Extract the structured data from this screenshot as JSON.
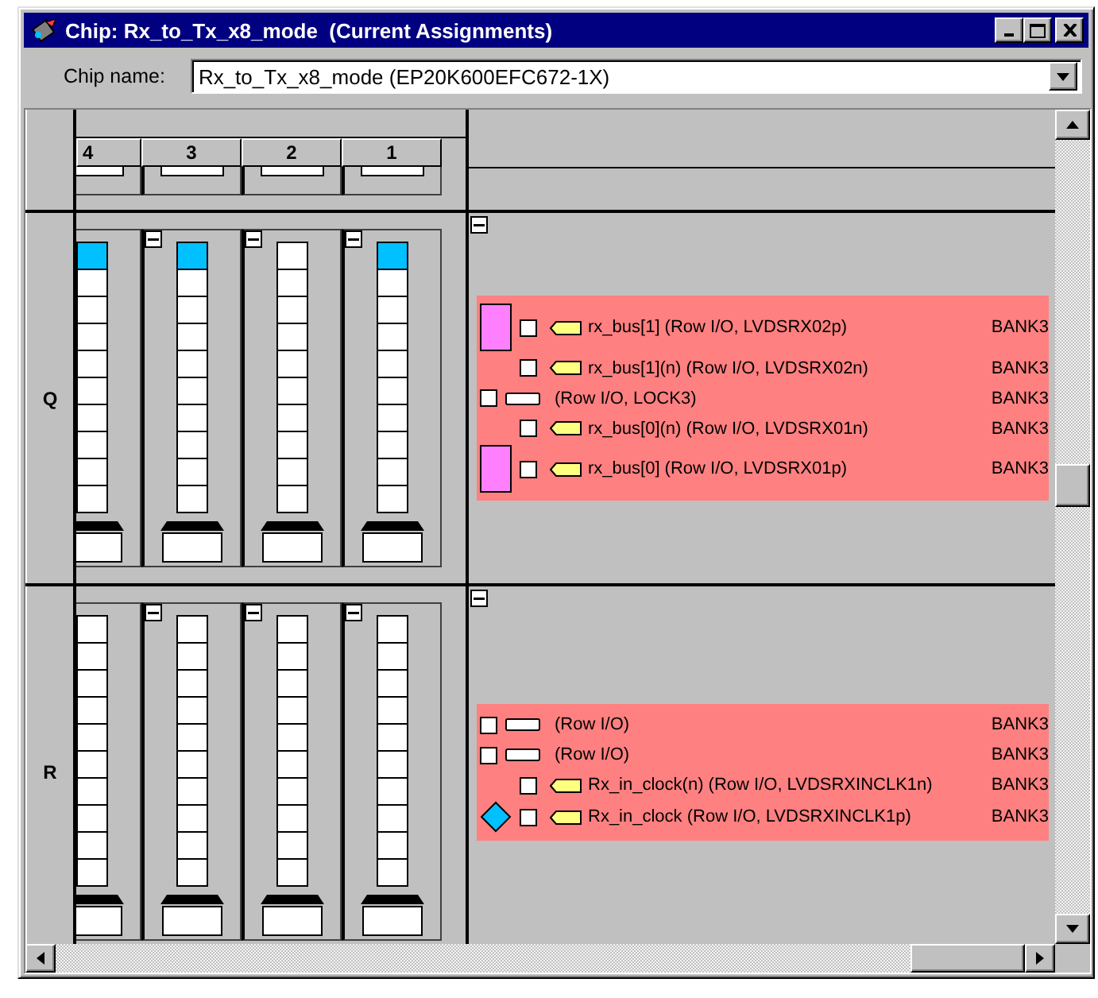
{
  "window": {
    "title": "Chip: Rx_to_Tx_x8_mode  (Current Assignments)"
  },
  "chip_name": {
    "label": "Chip name:",
    "value": "Rx_to_Tx_x8_mode (EP20K600EFC672-1X)"
  },
  "columns": [
    "4",
    "3",
    "2",
    "1"
  ],
  "rows": [
    {
      "label": "Q",
      "columns": [
        {
          "first_pin_assigned": true
        },
        {
          "first_pin_assigned": true
        },
        {
          "first_pin_assigned": false
        },
        {
          "first_pin_assigned": true
        }
      ],
      "assignments": [
        {
          "kind": "signal",
          "bar_marker": true,
          "diamond_marker": false,
          "checked": false,
          "text": "rx_bus[1] (Row I/O, LVDSRX02p)",
          "bank": "BANK3"
        },
        {
          "kind": "signal",
          "bar_marker": false,
          "diamond_marker": false,
          "checked": false,
          "text": "rx_bus[1](n) (Row I/O, LVDSRX02n)",
          "bank": "BANK3"
        },
        {
          "kind": "unassigned",
          "bar_marker": false,
          "diamond_marker": false,
          "checked": false,
          "text": "(Row I/O, LOCK3)",
          "bank": "BANK3"
        },
        {
          "kind": "signal",
          "bar_marker": false,
          "diamond_marker": false,
          "checked": false,
          "text": "rx_bus[0](n) (Row I/O, LVDSRX01n)",
          "bank": "BANK3"
        },
        {
          "kind": "signal",
          "bar_marker": true,
          "diamond_marker": false,
          "checked": false,
          "text": "rx_bus[0] (Row I/O, LVDSRX01p)",
          "bank": "BANK3"
        }
      ]
    },
    {
      "label": "R",
      "columns": [
        {
          "first_pin_assigned": false
        },
        {
          "first_pin_assigned": false
        },
        {
          "first_pin_assigned": false
        },
        {
          "first_pin_assigned": false
        }
      ],
      "assignments": [
        {
          "kind": "unassigned",
          "bar_marker": false,
          "diamond_marker": false,
          "checked": false,
          "text": "(Row I/O)",
          "bank": "BANK3"
        },
        {
          "kind": "unassigned",
          "bar_marker": false,
          "diamond_marker": false,
          "checked": false,
          "text": "(Row I/O)",
          "bank": "BANK3"
        },
        {
          "kind": "signal",
          "bar_marker": false,
          "diamond_marker": false,
          "checked": false,
          "text": "Rx_in_clock(n) (Row I/O, LVDSRXINCLK1n)",
          "bank": "BANK3"
        },
        {
          "kind": "signal",
          "bar_marker": false,
          "diamond_marker": true,
          "checked": false,
          "text": "Rx_in_clock (Row I/O, LVDSRXINCLK1p)",
          "bank": "BANK3"
        }
      ]
    }
  ]
}
